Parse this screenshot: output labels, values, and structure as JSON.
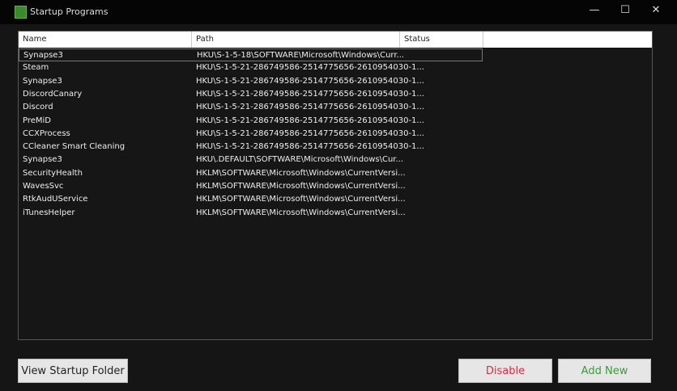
{
  "window": {
    "title": "Startup Programs",
    "minimize": "—",
    "maximize": "☐",
    "close": "✕"
  },
  "columns": [
    "Name",
    "Path",
    "Status"
  ],
  "rows": [
    {
      "name": "Synapse3",
      "path": "HKU\\S-1-5-18\\SOFTWARE\\Microsoft\\Windows\\Curr...",
      "status": ""
    },
    {
      "name": "Steam",
      "path": "HKU\\S-1-5-21-286749586-2514775656-2610954030-1...",
      "status": ""
    },
    {
      "name": "Synapse3",
      "path": "HKU\\S-1-5-21-286749586-2514775656-2610954030-1...",
      "status": ""
    },
    {
      "name": "DiscordCanary",
      "path": "HKU\\S-1-5-21-286749586-2514775656-2610954030-1...",
      "status": ""
    },
    {
      "name": "Discord",
      "path": "HKU\\S-1-5-21-286749586-2514775656-2610954030-1...",
      "status": ""
    },
    {
      "name": "PreMiD",
      "path": "HKU\\S-1-5-21-286749586-2514775656-2610954030-1...",
      "status": ""
    },
    {
      "name": "CCXProcess",
      "path": "HKU\\S-1-5-21-286749586-2514775656-2610954030-1...",
      "status": ""
    },
    {
      "name": "CCleaner Smart Cleaning",
      "path": "HKU\\S-1-5-21-286749586-2514775656-2610954030-1...",
      "status": ""
    },
    {
      "name": "Synapse3",
      "path": "HKU\\.DEFAULT\\SOFTWARE\\Microsoft\\Windows\\Cur...",
      "status": ""
    },
    {
      "name": "SecurityHealth",
      "path": "HKLM\\SOFTWARE\\Microsoft\\Windows\\CurrentVersi...",
      "status": ""
    },
    {
      "name": "WavesSvc",
      "path": "HKLM\\SOFTWARE\\Microsoft\\Windows\\CurrentVersi...",
      "status": ""
    },
    {
      "name": "RtkAudUService",
      "path": "HKLM\\SOFTWARE\\Microsoft\\Windows\\CurrentVersi...",
      "status": ""
    },
    {
      "name": "iTunesHelper",
      "path": "HKLM\\SOFTWARE\\Microsoft\\Windows\\CurrentVersi...",
      "status": ""
    }
  ],
  "buttons": {
    "view_folder": "View Startup Folder",
    "disable": "Disable",
    "add_new": "Add New"
  },
  "colors": {
    "disable": "#e8283c",
    "add_new": "#3a9a3a"
  }
}
